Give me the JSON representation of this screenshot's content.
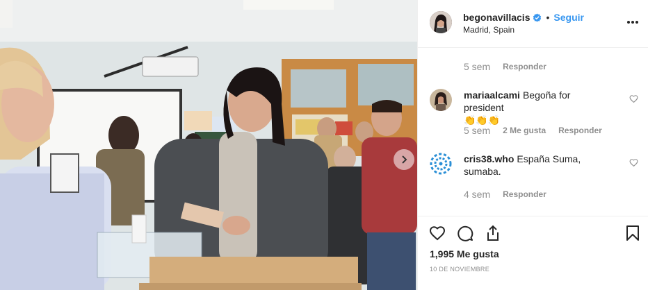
{
  "post": {
    "username": "begonavillacis",
    "follow_label": "Seguir",
    "separator": "•",
    "location": "Madrid, Spain",
    "likes_text": "1,995 Me gusta",
    "date": "10 DE NOVIEMBRE"
  },
  "comments": [
    {
      "username": "",
      "text": "",
      "time": "5 sem",
      "likes": "",
      "reply_label": "Responder"
    },
    {
      "username": "mariaalcami",
      "text": "Begoña for president",
      "emoji": "👏👏👏",
      "time": "5 sem",
      "likes": "2 Me gusta",
      "reply_label": "Responder"
    },
    {
      "username": "cris38.who",
      "text": "España Suma, sumaba.",
      "time": "4 sem",
      "likes": "",
      "reply_label": "Responder"
    }
  ],
  "icons": {
    "verified": "verified-badge-icon",
    "more": "more-options-icon",
    "like": "heart-icon",
    "comment": "comment-icon",
    "share": "share-icon",
    "save": "bookmark-icon",
    "next": "chevron-right-icon"
  },
  "colors": {
    "accent": "#3897f0",
    "muted": "#8e8e8e",
    "text": "#262626",
    "border": "#efefef"
  }
}
